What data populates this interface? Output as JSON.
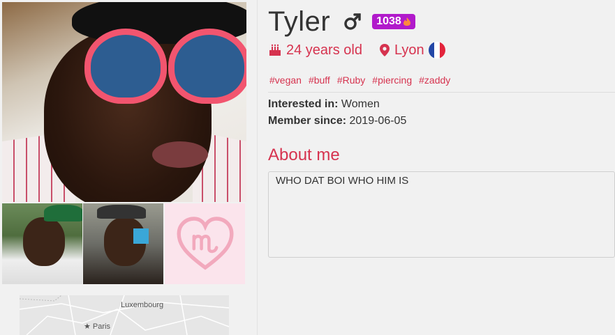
{
  "profile": {
    "name": "Tyler",
    "gender_icon": "male-icon",
    "score": "1038",
    "score_icon": "flame-icon",
    "age": "24 years old",
    "city": "Lyon",
    "country_flag": "france-flag-icon",
    "tags": [
      "#vegan",
      "#buff",
      "#Ruby",
      "#piercing",
      "#zaddy"
    ],
    "interested_label": "Interested in:",
    "interested_value": "Women",
    "member_label": "Member since:",
    "member_value": "2019-06-05",
    "about_title": "About me",
    "about_text": "WHO DAT BOI WHO HIM IS"
  },
  "map": {
    "labels": [
      "Luxembourg",
      "Paris"
    ]
  },
  "colors": {
    "accent": "#d6334f",
    "score_badge": "#b11acb",
    "logo_pink": "#f2a9bd"
  }
}
